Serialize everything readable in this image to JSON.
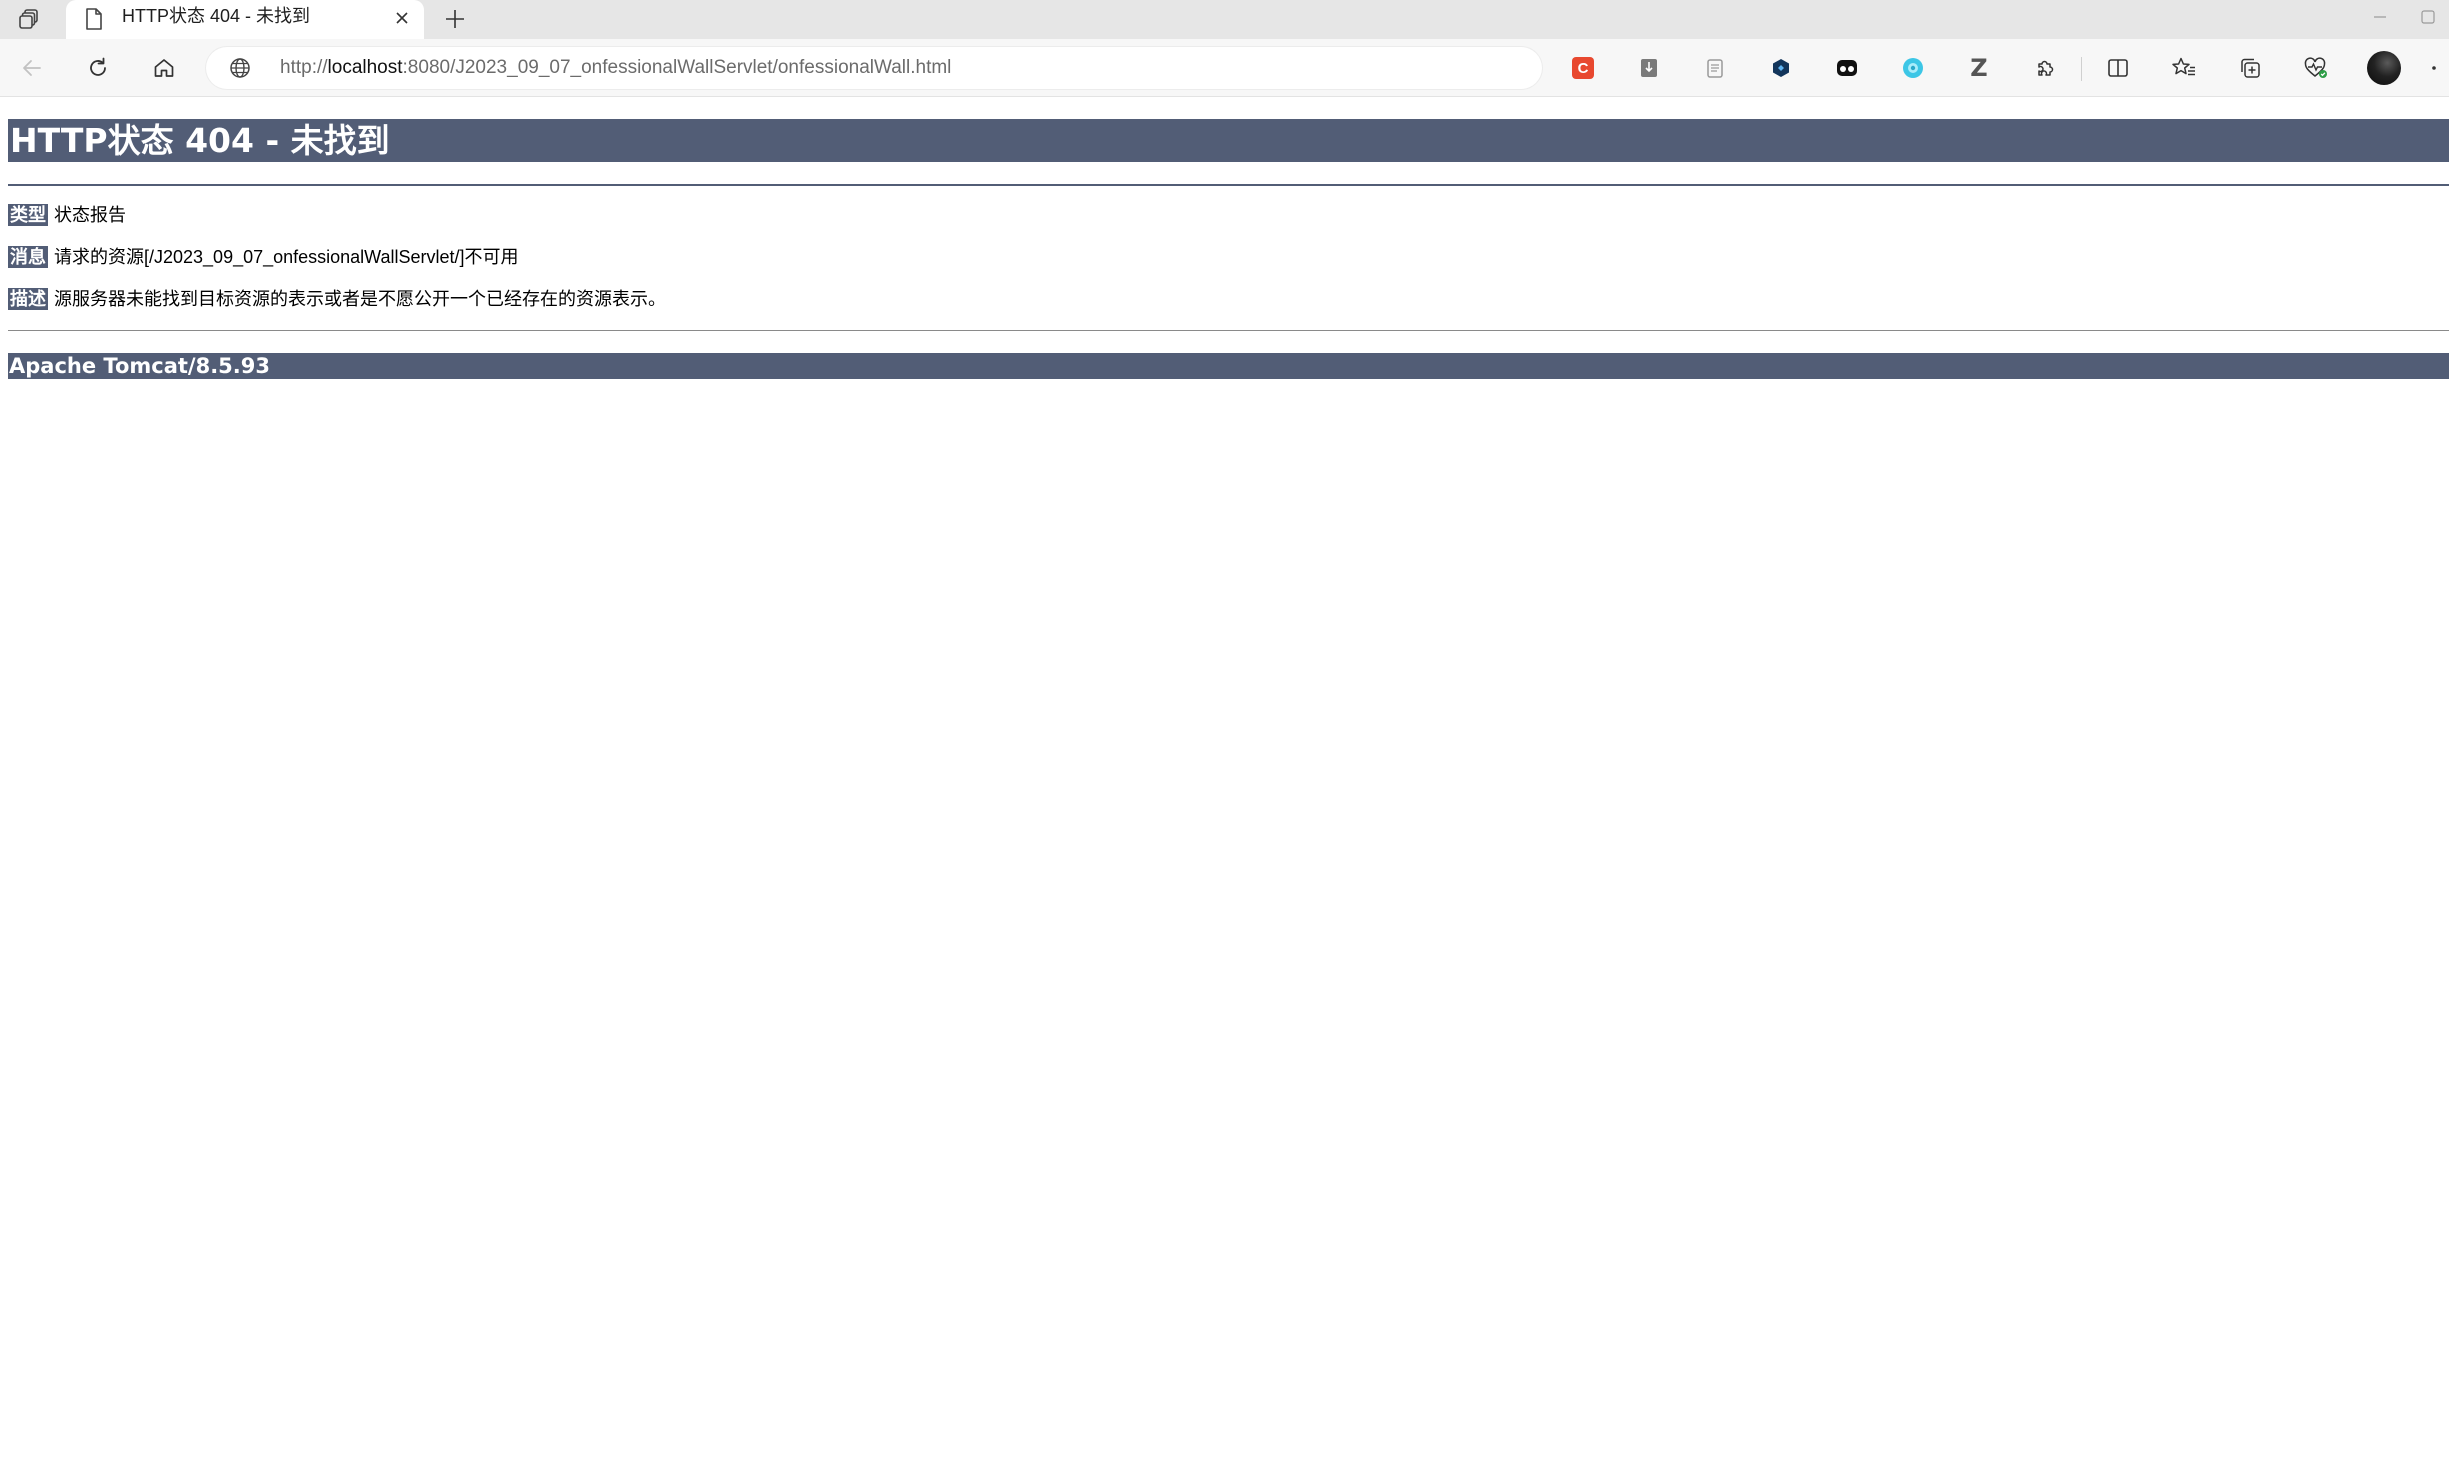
{
  "tab": {
    "title": "HTTP状态 404 - 未找到"
  },
  "address": {
    "scheme": "http://",
    "host": "localhost",
    "path": ":8080/J2023_09_07_onfessionalWallServlet/onfessionalWall.html"
  },
  "extensions": [
    {
      "name": "extension-red-c",
      "glyph": "C",
      "color": "#e8482f"
    },
    {
      "name": "extension-grey-box",
      "glyph": "",
      "color": "#7a7a7a"
    },
    {
      "name": "extension-clipboard",
      "glyph": "",
      "color": "#9a9a9a"
    },
    {
      "name": "extension-dark-hex",
      "glyph": "",
      "color": "#12355b"
    },
    {
      "name": "extension-black-mask",
      "glyph": "",
      "color": "#111111"
    },
    {
      "name": "extension-cyan-circle",
      "glyph": "",
      "color": "#3cc6e6"
    },
    {
      "name": "extension-z",
      "glyph": "Z",
      "color": "#555555"
    }
  ],
  "page": {
    "heading": "HTTP状态 404 - 未找到",
    "rows": [
      {
        "label": "类型",
        "text": "状态报告"
      },
      {
        "label": "消息",
        "text": "请求的资源[/J2023_09_07_onfessionalWallServlet/]不可用"
      },
      {
        "label": "描述",
        "text": "源服务器未能找到目标资源的表示或者是不愿公开一个已经存在的资源表示。"
      }
    ],
    "footer": "Apache Tomcat/8.5.93"
  },
  "colors": {
    "tomcat_bar": "#525d76",
    "tab_strip": "#e6e6e6",
    "toolbar": "#f7f7f7"
  }
}
